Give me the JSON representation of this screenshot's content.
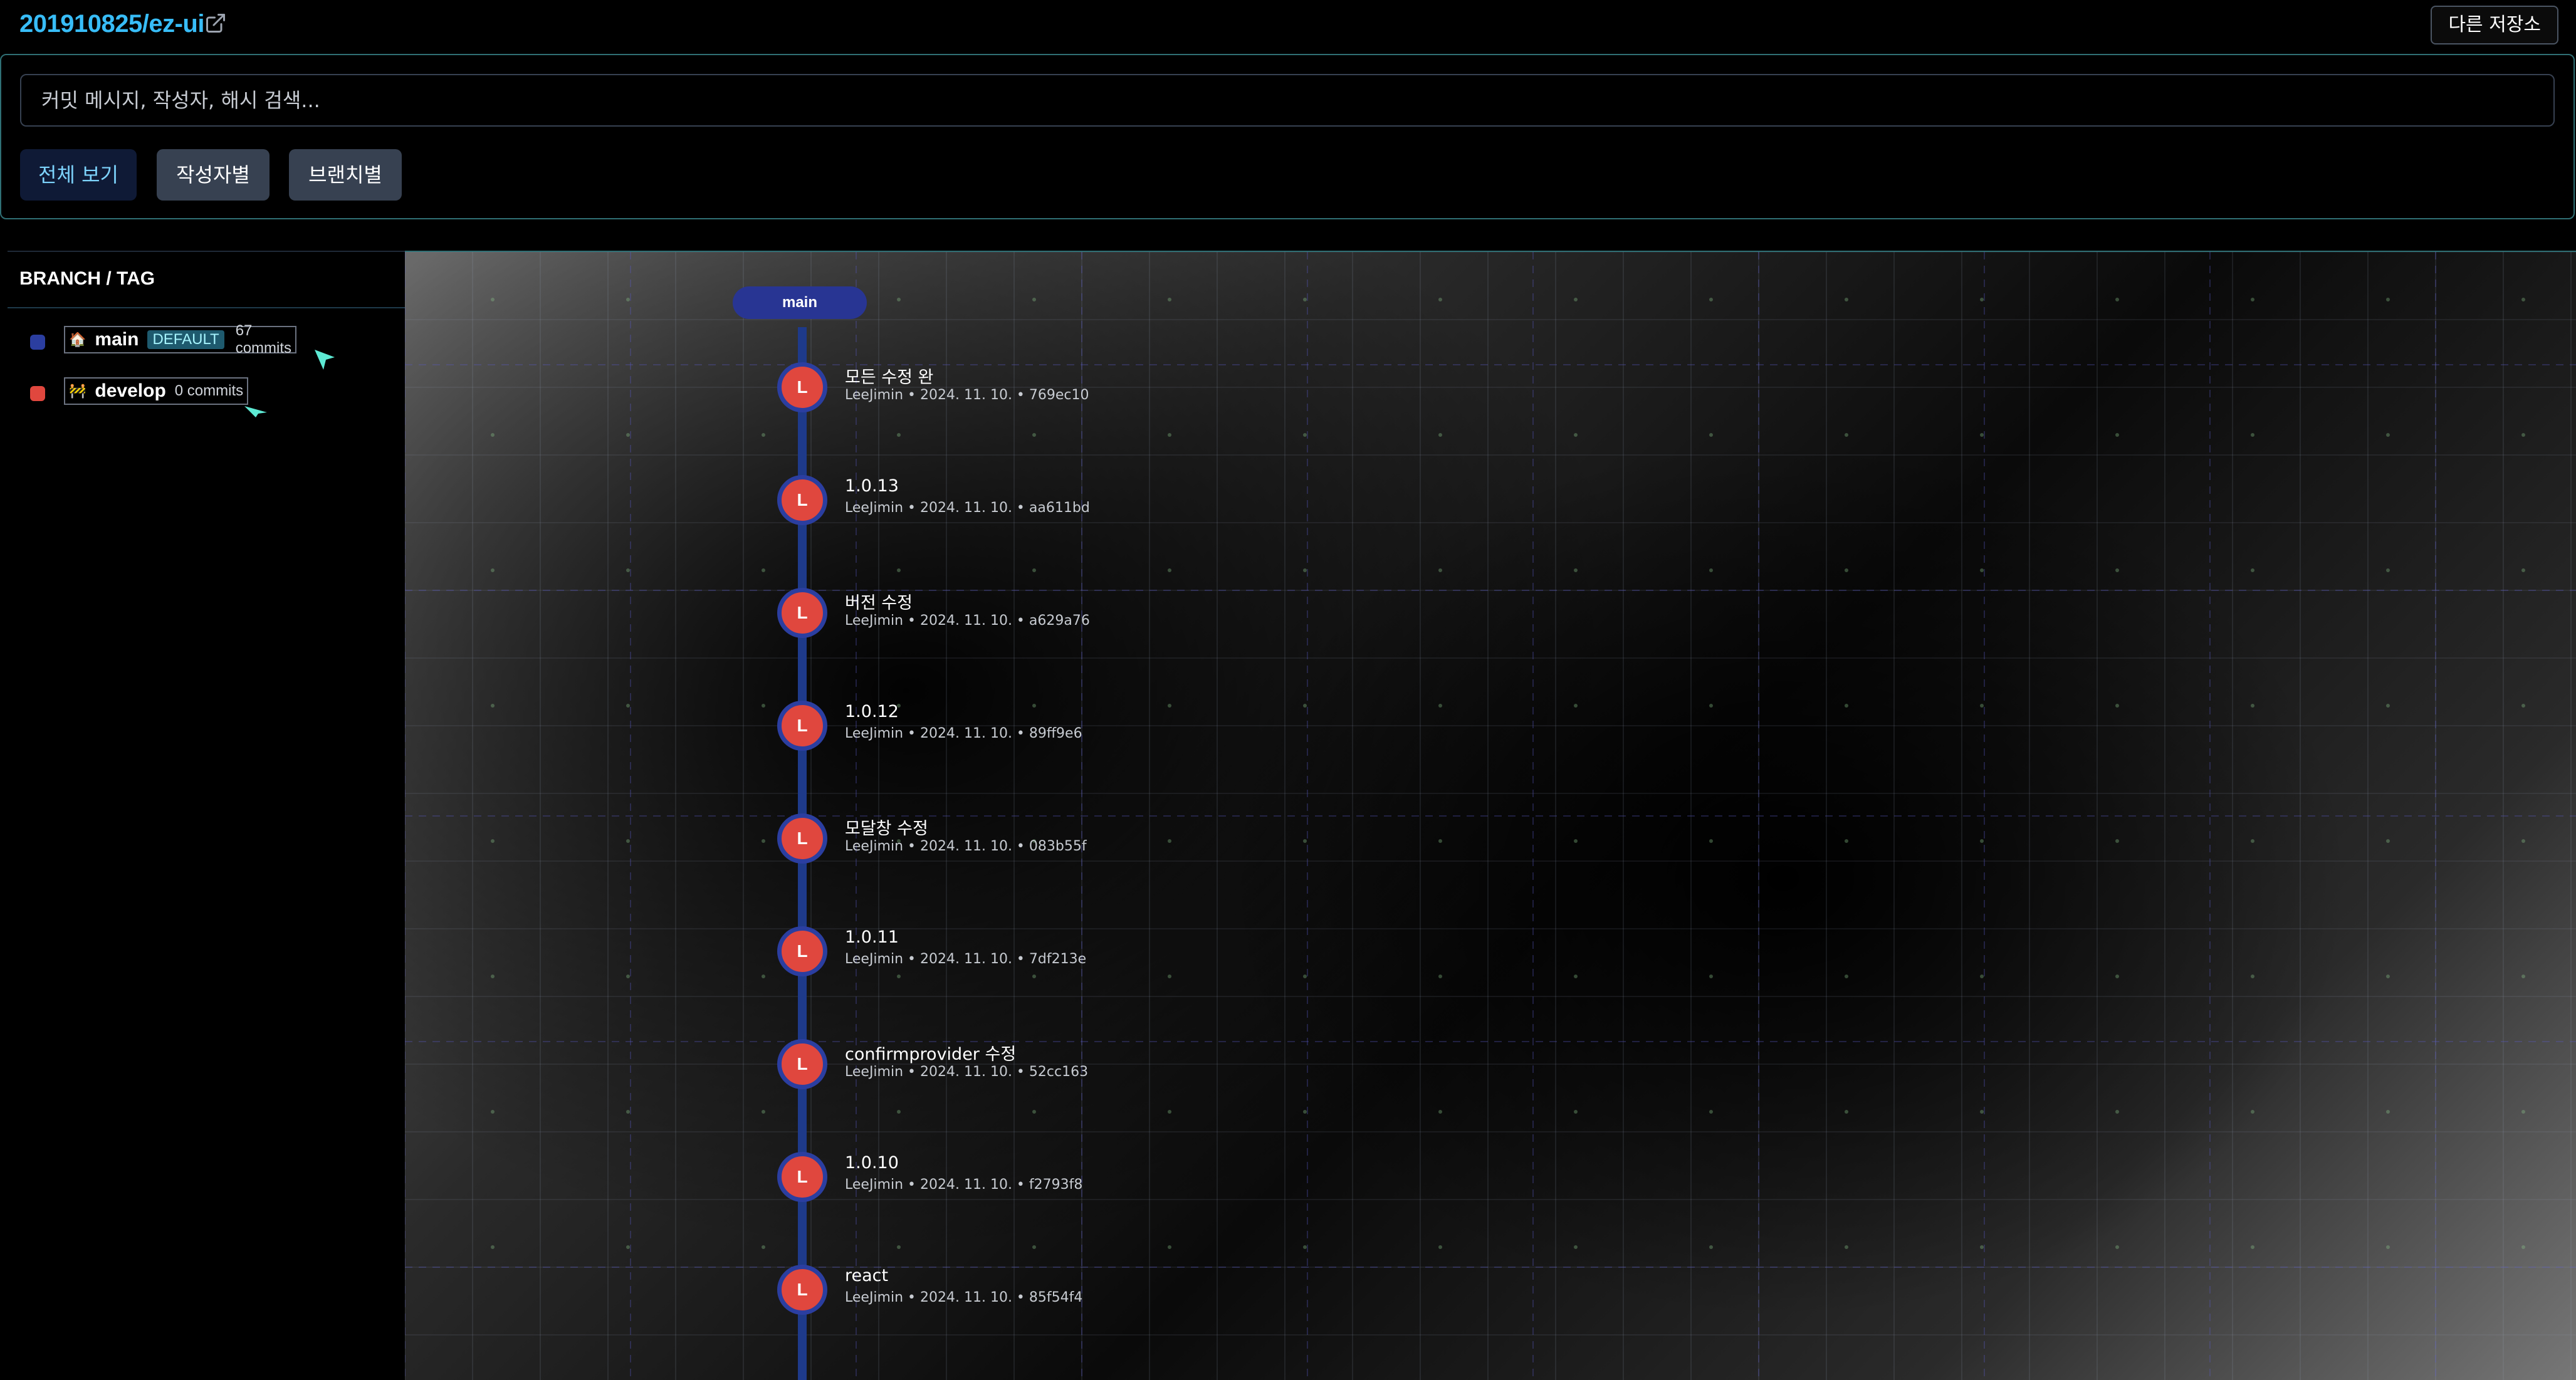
{
  "header": {
    "repo_title": "201910825/ez-ui",
    "external_link_icon": "external-link-icon",
    "switch_repo_label": "다른 저장소"
  },
  "search": {
    "placeholder": "커밋 메시지, 작성자, 해시 검색...",
    "value": "",
    "filters": [
      {
        "label": "전체 보기",
        "active": true
      },
      {
        "label": "작성자별",
        "active": false
      },
      {
        "label": "브랜치별",
        "active": false
      }
    ]
  },
  "sidebar": {
    "title": "BRANCH / TAG",
    "branches": [
      {
        "icon": "house-icon",
        "emoji": "🏠",
        "name": "main",
        "badge": "DEFAULT",
        "count": "67 commits",
        "color": "#2b3ea0"
      },
      {
        "icon": "construction-icon",
        "emoji": "🚧",
        "name": "develop",
        "badge": "",
        "count": "0 commits",
        "color": "#e0473e"
      }
    ]
  },
  "graph": {
    "branch_label": "main",
    "line_color": "#1e3a8a",
    "avatar_color": "#e0473e",
    "commits": [
      {
        "avatar": "L",
        "message": "모든 수정 완",
        "meta": "LeeJimin • 2024. 11. 10. • 769ec10"
      },
      {
        "avatar": "L",
        "message": "1.0.13",
        "meta": "LeeJimin • 2024. 11. 10. • aa611bd"
      },
      {
        "avatar": "L",
        "message": "버전 수정",
        "meta": "LeeJimin • 2024. 11. 10. • a629a76"
      },
      {
        "avatar": "L",
        "message": "1.0.12",
        "meta": "LeeJimin • 2024. 11. 10. • 89ff9e6"
      },
      {
        "avatar": "L",
        "message": "모달창 수정",
        "meta": "LeeJimin • 2024. 11. 10. • 083b55f"
      },
      {
        "avatar": "L",
        "message": "1.0.11",
        "meta": "LeeJimin • 2024. 11. 10. • 7df213e"
      },
      {
        "avatar": "L",
        "message": "confirmprovider 수정",
        "meta": "LeeJimin • 2024. 11. 10. • 52cc163"
      },
      {
        "avatar": "L",
        "message": "1.0.10",
        "meta": "LeeJimin • 2024. 11. 10. • f2793f8"
      },
      {
        "avatar": "L",
        "message": "react",
        "meta": "LeeJimin • 2024. 11. 10. • 85f54f4"
      }
    ]
  }
}
